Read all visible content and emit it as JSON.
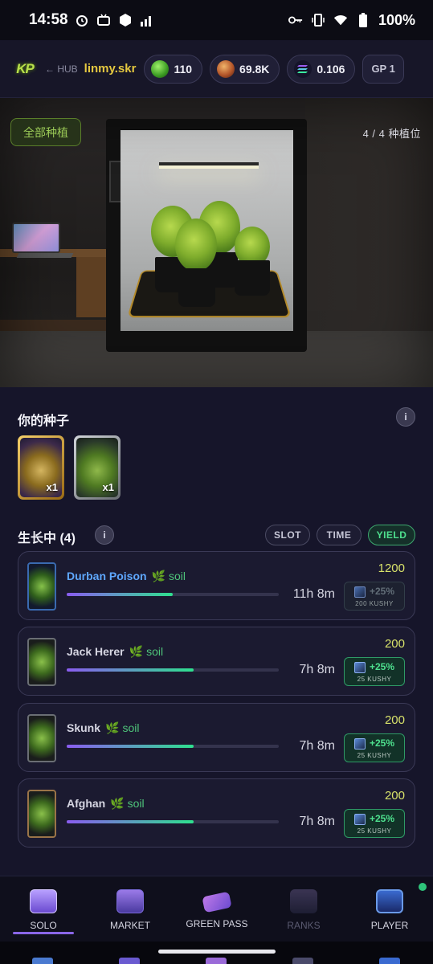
{
  "status_bar": {
    "time": "14:58",
    "battery": "100%"
  },
  "header": {
    "logo": "KP",
    "hub_label": "← HUB",
    "username": "linmy.skr",
    "currencies": [
      {
        "icon": "green-gem-icon",
        "value": "110"
      },
      {
        "icon": "orange-token-icon",
        "value": "69.8K"
      },
      {
        "icon": "solana-icon",
        "value": "0.106"
      }
    ],
    "gp_label": "GP 1"
  },
  "hero": {
    "all_plant_button": "全部种植",
    "slot_count": "4 / 4 种植位"
  },
  "seeds": {
    "title": "你的种子",
    "info": "i",
    "items": [
      {
        "name": "gold-seed-card",
        "qty": "x1"
      },
      {
        "name": "silver-seed-card",
        "qty": "x1"
      }
    ]
  },
  "growing": {
    "title": "生长中 (4)",
    "info": "i",
    "sort_buttons": [
      "SLOT",
      "TIME",
      "YIELD"
    ],
    "active_sort": "YIELD",
    "plants": [
      {
        "name": "Durban Poison",
        "soil": "soil",
        "progress": 0.5,
        "timer": "11h 8m",
        "yield": "1200",
        "boost": "+25%",
        "boost_cost": "200 KUSHY"
      },
      {
        "name": "Jack Herer",
        "soil": "soil",
        "progress": 0.6,
        "timer": "7h 8m",
        "yield": "200",
        "boost": "+25%",
        "boost_cost": "25 KUSHY"
      },
      {
        "name": "Skunk",
        "soil": "soil",
        "progress": 0.6,
        "timer": "7h 8m",
        "yield": "200",
        "boost": "+25%",
        "boost_cost": "25 KUSHY"
      },
      {
        "name": "Afghan",
        "soil": "soil",
        "progress": 0.6,
        "timer": "7h 8m",
        "yield": "200",
        "boost": "+25%",
        "boost_cost": "25 KUSHY"
      }
    ]
  },
  "nav": {
    "items": [
      {
        "label": "SOLO",
        "icon": "seed-box-icon",
        "active": true
      },
      {
        "label": "MARKET",
        "icon": "market-stall-icon"
      },
      {
        "label": "GREEN PASS",
        "icon": "ticket-icon"
      },
      {
        "label": "RANKS",
        "icon": "trophy-icon",
        "disabled": true
      },
      {
        "label": "PLAYER",
        "icon": "player-portrait-icon"
      }
    ]
  },
  "colors": {
    "background": "#16152a",
    "accent_green": "#4ee08e",
    "username_gold": "#e5c840",
    "progress_start": "#8a5cf0",
    "progress_end": "#2ee08e",
    "rare_name_blue": "#5fa8ff"
  }
}
